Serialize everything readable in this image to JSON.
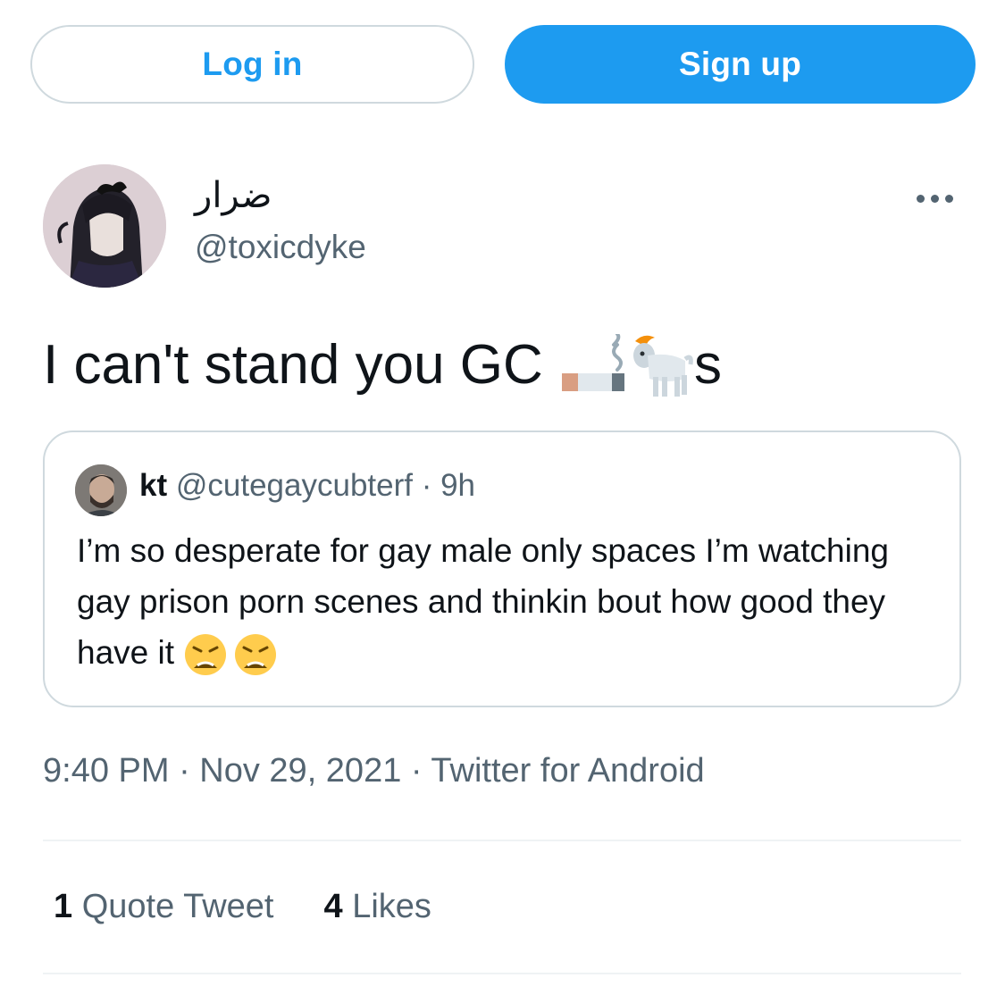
{
  "auth": {
    "login_label": "Log in",
    "signup_label": "Sign up"
  },
  "tweet": {
    "display_name": "ضرار",
    "handle": "@toxicdyke",
    "text_before": "I can't stand you GC ",
    "text_emojis": [
      "cigarette-emoji",
      "goat-emoji"
    ],
    "text_after": "s",
    "timestamp": "9:40 PM · Nov 29, 2021 · Twitter for Android"
  },
  "quote": {
    "name": "kt",
    "meta": "@cutegaycubterf · 9h",
    "body": "I’m so desperate for gay male only spaces I’m watching gay prison porn scenes and thinkin bout how good they have it ",
    "emojis": [
      "weary-face-emoji",
      "weary-face-emoji"
    ]
  },
  "stats": {
    "quote_count": "1",
    "quote_label": "Quote Tweet",
    "like_count": "4",
    "like_label": "Likes"
  },
  "colors": {
    "accent": "#1d9bf0",
    "secondary_text": "#536471",
    "border": "#cfd9de"
  }
}
